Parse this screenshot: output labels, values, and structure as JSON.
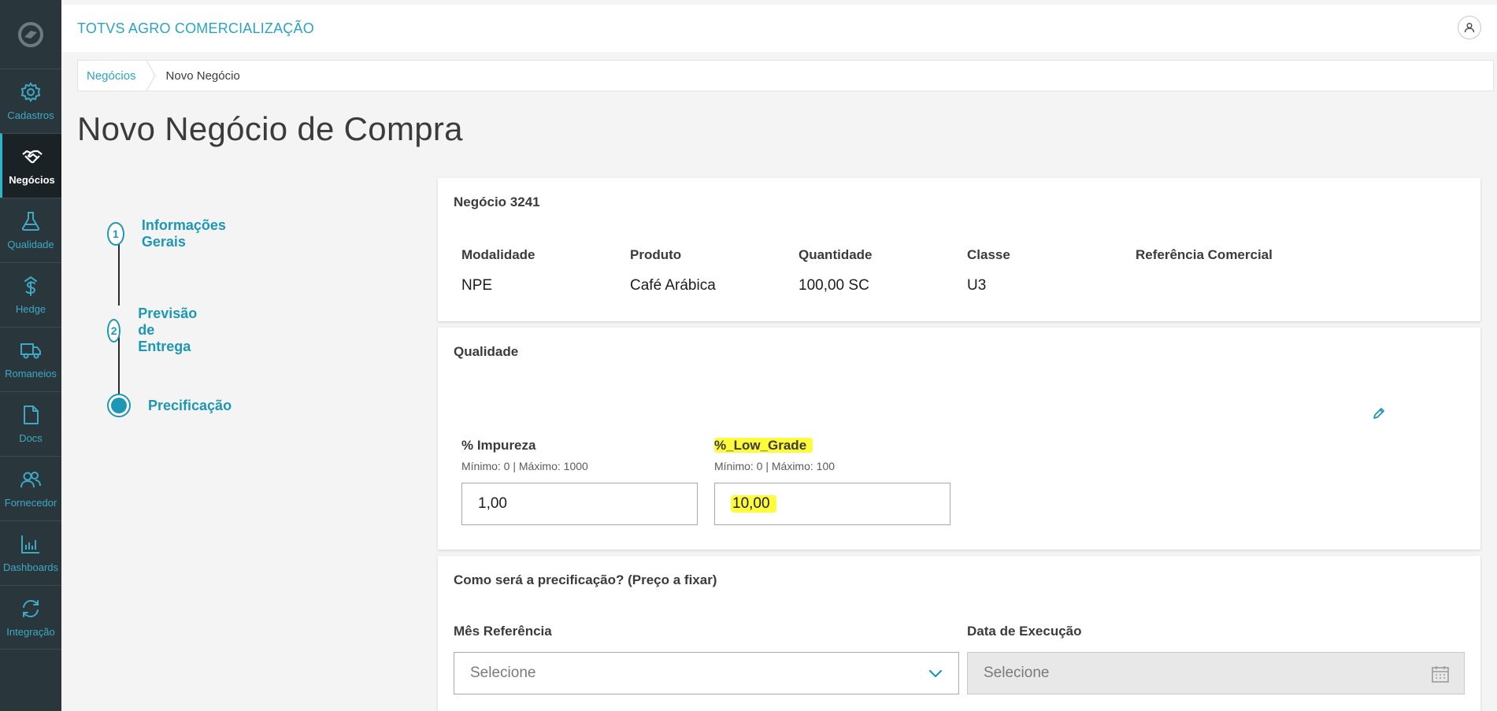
{
  "app": {
    "title": "TOTVS AGRO COMERCIALIZAÇÃO"
  },
  "sidebar": {
    "items": [
      {
        "label": "Cadastros",
        "icon": "gear-icon"
      },
      {
        "label": "Negócios",
        "icon": "handshake-icon",
        "active": true
      },
      {
        "label": "Qualidade",
        "icon": "flask-icon"
      },
      {
        "label": "Hedge",
        "icon": "dollar-icon"
      },
      {
        "label": "Romaneios",
        "icon": "truck-icon"
      },
      {
        "label": "Docs",
        "icon": "document-icon"
      },
      {
        "label": "Fornecedor",
        "icon": "users-icon"
      },
      {
        "label": "Dashboards",
        "icon": "bar-chart-icon"
      },
      {
        "label": "Integração",
        "icon": "sync-icon"
      }
    ]
  },
  "breadcrumb": {
    "items": [
      "Negócios",
      "Novo Negócio"
    ]
  },
  "page": {
    "title": "Novo Negócio de Compra"
  },
  "stepper": {
    "steps": [
      {
        "number": "1",
        "label": "Informações Gerais"
      },
      {
        "number": "2",
        "label": "Previsão de Entrega"
      },
      {
        "number": "",
        "label": "Precificação",
        "current": true
      }
    ]
  },
  "deal_card": {
    "title": "Negócio 3241",
    "fields": [
      {
        "label": "Modalidade",
        "value": "NPE"
      },
      {
        "label": "Produto",
        "value": "Café Arábica"
      },
      {
        "label": "Quantidade",
        "value": "100,00 SC"
      },
      {
        "label": "Classe",
        "value": "U3"
      },
      {
        "label": "Referência Comercial",
        "value": ""
      }
    ]
  },
  "quality_card": {
    "title": "Qualidade",
    "fields": [
      {
        "label": "% Impureza",
        "hint": "Mínimo: 0 | Máximo: 1000",
        "value": "1,00"
      },
      {
        "label": "%_Low_Grade",
        "hint": "Mínimo: 0 | Máximo: 100",
        "value": "10,00"
      }
    ]
  },
  "pricing_card": {
    "title": "Como será a precificação? (Preço a fixar)",
    "month_label": "Mês Referência",
    "month_placeholder": "Selecione",
    "date_label": "Data de Execução",
    "date_placeholder": "Selecione"
  },
  "colors": {
    "sidebar_bg": "#29363c",
    "accent": "#2aa4c2",
    "highlight": "#fdfb3a"
  }
}
